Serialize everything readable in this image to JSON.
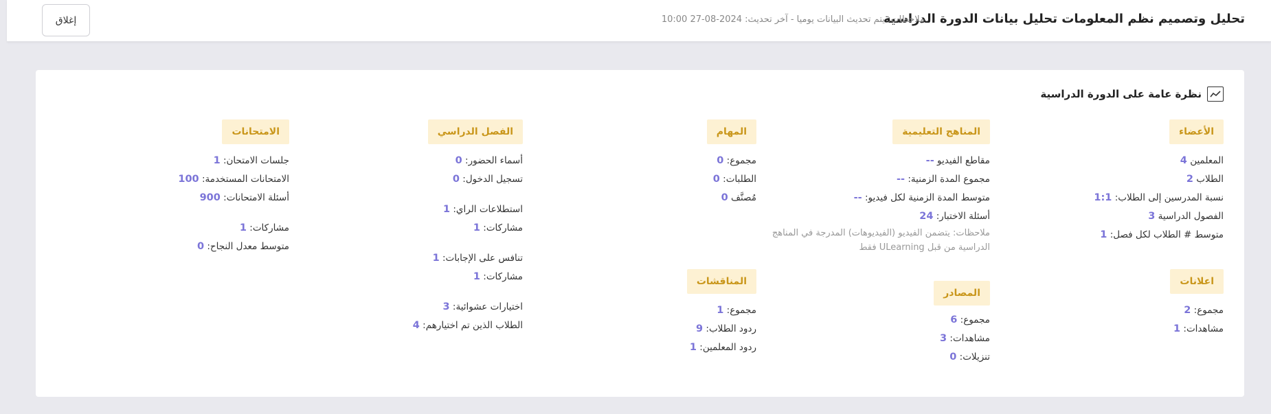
{
  "header": {
    "title": "تحليل وتصميم نظم المعلومات تحليل بيانات الدورة الدراسية",
    "notes": "ملاحظات: يتم تحديث البيانات يوميا - آخر تحديث: 2024-08-27 10:00",
    "close_label": "إغلاق"
  },
  "overview": {
    "title": "نظرة عامة على الدورة الدراسية",
    "icon": "line-chart-icon"
  },
  "sections": {
    "members": {
      "title": "الأعضاء",
      "rows": [
        {
          "label": "المعلمين",
          "value": "4"
        },
        {
          "label": "الطلاب",
          "value": "2"
        },
        {
          "label": "نسبة المدرسين إلى الطلاب:",
          "value": "1:1"
        },
        {
          "label": "الفصول الدراسية",
          "value": "3"
        },
        {
          "label": "متوسط # الطلاب لكل فصل:",
          "value": "1"
        }
      ]
    },
    "announcements": {
      "title": "اعلانات",
      "rows": [
        {
          "label": "مجموع:",
          "value": "2"
        },
        {
          "label": "مشاهدات:",
          "value": "1"
        }
      ]
    },
    "curricula": {
      "title": "المناهج التعليمية",
      "rows": [
        {
          "label": "مقاطع الفيديو",
          "value": "--"
        },
        {
          "label": "مجموع المدة الزمنية:",
          "value": "--"
        },
        {
          "label": "متوسط المدة الزمنية لكل فيديو:",
          "value": "--"
        },
        {
          "label": "أسئلة الاختبار:",
          "value": "24"
        }
      ],
      "note": "ملاحظات: يتضمن الفيديو (الفيديوهات) المدرجة في المناهج الدراسية من قبل ULearning فقط"
    },
    "resources": {
      "title": "المصادر",
      "rows": [
        {
          "label": "مجموع:",
          "value": "6"
        },
        {
          "label": "مشاهدات:",
          "value": "3"
        },
        {
          "label": "تنزيلات:",
          "value": "0"
        }
      ]
    },
    "tasks": {
      "title": "المهام",
      "rows": [
        {
          "label": "مجموع:",
          "value": "0"
        },
        {
          "label": "الطلبات:",
          "value": "0"
        },
        {
          "label": "مُصنَّف",
          "value": "0"
        }
      ]
    },
    "discussions": {
      "title": "المناقشات",
      "rows": [
        {
          "label": "مجموع:",
          "value": "1"
        },
        {
          "label": "ردود الطلاب:",
          "value": "9"
        },
        {
          "label": "ردود المعلمين:",
          "value": "1"
        }
      ]
    },
    "classroom": {
      "title": "الفصل الدراسي",
      "rows": [
        {
          "label": "أسماء الحضور:",
          "value": "0"
        },
        {
          "label": "تسجيل الدخول:",
          "value": "0"
        },
        {
          "label": "استطلاعات الراي:",
          "value": "1"
        },
        {
          "label": "مشاركات:",
          "value": "1"
        },
        {
          "label": "تنافس على الإجابات:",
          "value": "1"
        },
        {
          "label": "مشاركات:",
          "value": "1"
        },
        {
          "label": "اختيارات عشوائية:",
          "value": "3"
        },
        {
          "label": "الطلاب الذين تم اختيارهم:",
          "value": "4"
        }
      ]
    },
    "exams": {
      "title": "الامتحانات",
      "rows": [
        {
          "label": "جلسات الامتحان:",
          "value": "1"
        },
        {
          "label": "الامتحانات المستخدمة:",
          "value": "100"
        },
        {
          "label": "أسئلة الامتحانات:",
          "value": "900"
        },
        {
          "label": "مشاركات:",
          "value": "1"
        },
        {
          "label": "متوسط معدل النجاح:",
          "value": "0"
        }
      ]
    }
  },
  "colors": {
    "badge_bg": "#fdf1d3",
    "badge_text": "#c9961a",
    "value": "#7b74d8"
  }
}
